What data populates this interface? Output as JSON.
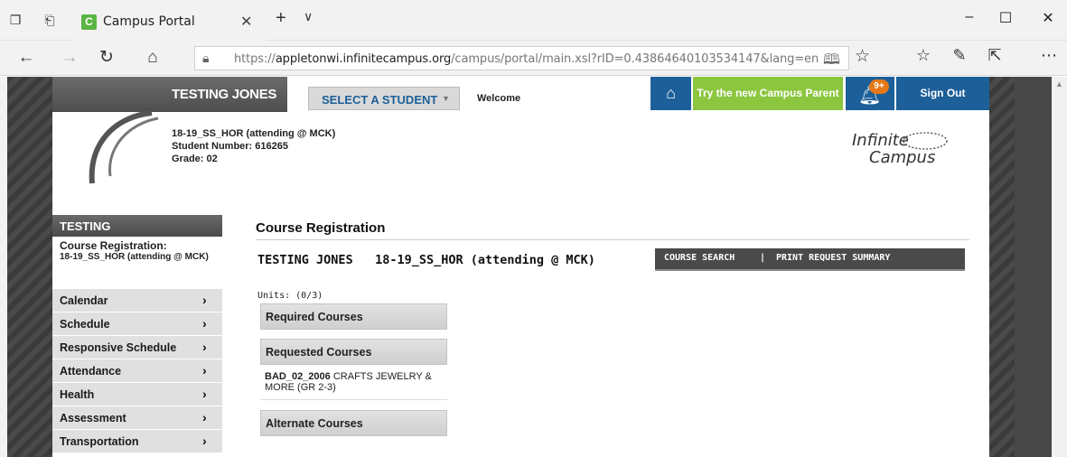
{
  "browser": {
    "tab_title": "Campus Portal",
    "tab_favicon_letter": "C",
    "url_scheme": "https://",
    "url_domain": "appletonwi.infinitecampus.org",
    "url_path": "/campus/portal/main.xsl?rID=0.43864640103534147&lang=en"
  },
  "header": {
    "student_name": "TESTING JONES",
    "select_student_label": "SELECT A STUDENT",
    "welcome": "Welcome",
    "try_new_label": "Try the new Campus Parent",
    "notification_badge": "9+",
    "sign_out_label": "Sign Out"
  },
  "student": {
    "enrollment": "18-19_SS_HOR (attending @ MCK)",
    "student_number": "Student Number: 616265",
    "grade": "Grade: 02"
  },
  "logo": {
    "line1": "Infinite",
    "line2": "Campus"
  },
  "sidebar": {
    "header": "TESTING",
    "current_title": "Course Registration:",
    "current_sub": "18-19_SS_HOR (attending @ MCK)",
    "items": [
      {
        "label": "Calendar"
      },
      {
        "label": "Schedule"
      },
      {
        "label": "Responsive Schedule"
      },
      {
        "label": "Attendance"
      },
      {
        "label": "Health"
      },
      {
        "label": "Assessment"
      },
      {
        "label": "Transportation"
      }
    ]
  },
  "main": {
    "title": "Course Registration",
    "reg_student": "TESTING JONES",
    "reg_enrollment": "18-19_SS_HOR (attending @ MCK)",
    "course_search_label": "COURSE SEARCH",
    "separator": "|",
    "print_summary_label": "PRINT REQUEST SUMMARY",
    "units": "Units: (0/3)",
    "required_label": "Required Courses",
    "requested_label": "Requested Courses",
    "alternate_label": "Alternate Courses",
    "course_code": "BAD_02_2006",
    "course_name": "CRAFTS JEWELRY & MORE (GR 2-3)"
  },
  "colors": {
    "brand_blue": "#1c5f99",
    "brand_green": "#8cc63f",
    "badge_orange": "#e77817"
  }
}
